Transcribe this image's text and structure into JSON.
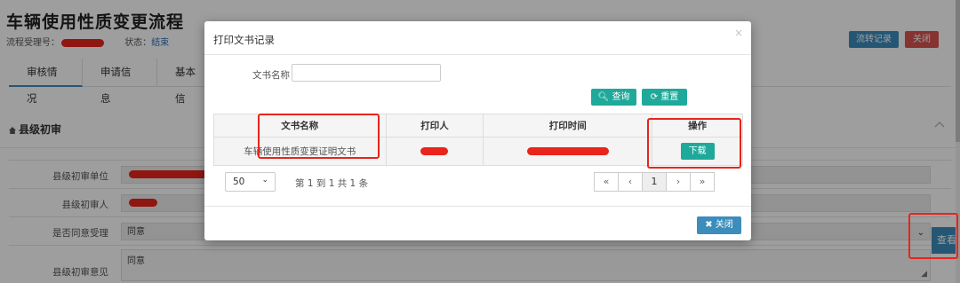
{
  "page": {
    "title": "车辆使用性质变更流程",
    "flow_no_label": "流程受理号：",
    "status_label": "状态：",
    "status_value": "结束",
    "btn_flow_record": "流转记录",
    "btn_close": "关闭",
    "tabs": [
      {
        "label": "审核情况"
      },
      {
        "label": "申请信息"
      },
      {
        "label": "基本信"
      }
    ],
    "section_title": "县级初审",
    "form": {
      "unit_label": "县级初审单位",
      "person_label": "县级初审人",
      "accept_label": "是否同意受理",
      "accept_value": "同意",
      "opinion_label": "县级初审意见",
      "opinion_value": "同意"
    },
    "btn_view": "查看"
  },
  "modal": {
    "title": "打印文书记录",
    "close_glyph": "×",
    "search_label": "文书名称",
    "search_placeholder": "",
    "btn_query": "查询",
    "btn_reset": "重置",
    "table": {
      "headers": [
        "文书名称",
        "打印人",
        "打印时间",
        "操作"
      ],
      "rows": [
        {
          "doc_name": "车辆使用性质变更证明文书",
          "action": "下载"
        }
      ]
    },
    "page_size": "50",
    "page_info": "第 1 到 1 共 1 条",
    "pager": [
      "«",
      "‹",
      "1",
      "›",
      "»"
    ],
    "btn_close": "关闭"
  },
  "colors": {
    "primary": "#3c8dbc",
    "teal": "#1fa99a",
    "danger": "#d9534f",
    "annotation_red": "#e8241c"
  }
}
